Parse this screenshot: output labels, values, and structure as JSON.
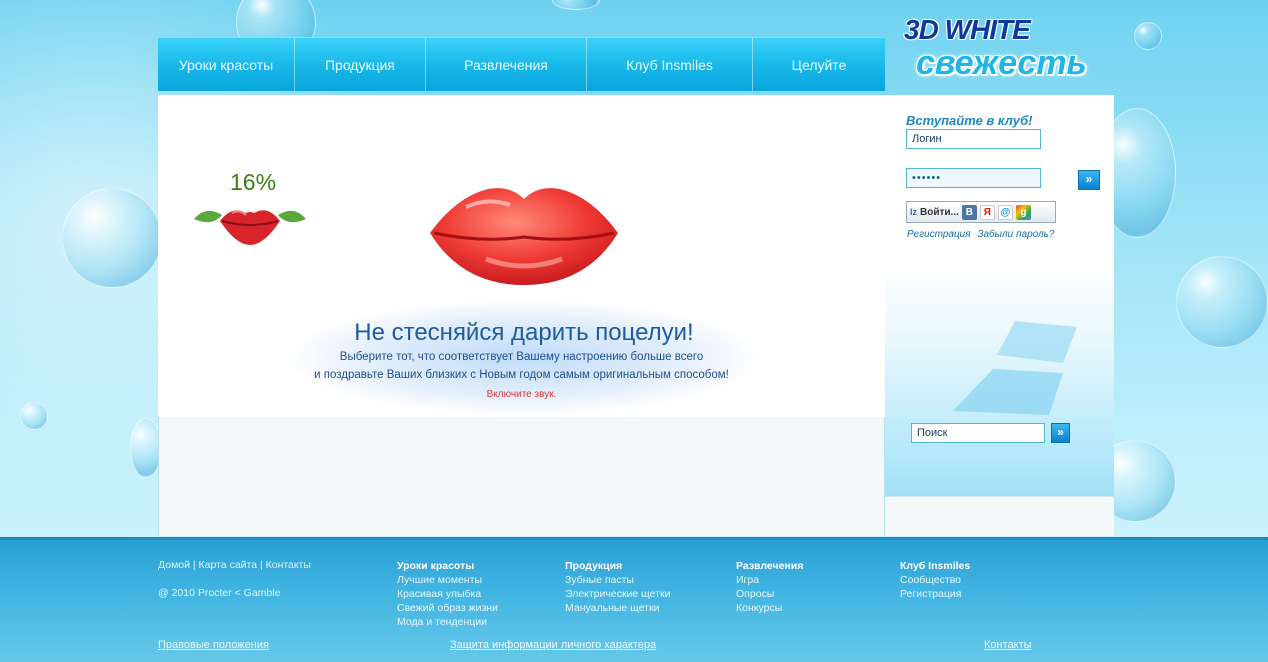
{
  "logo": {
    "line1": "3D WHITE",
    "line2": "свежесть"
  },
  "nav": {
    "items": [
      "Уроки красоты",
      "Продукция",
      "Развлечения",
      "Клуб Insmiles",
      "Целуйте"
    ]
  },
  "promo": {
    "progress_label": "16%",
    "progress": 0.16,
    "headline": "Не стесняйся дарить поцелуи!",
    "line1": "Выберите тот, что соответствует Вашему настроению больше всего",
    "line2": "и поздравьте Ваших близких с Новым годом самым оригинальным способом!",
    "sound_note": "Включите звук."
  },
  "sidebar": {
    "join_title": "Вступайте в клуб!",
    "login_value": "Логин",
    "password_value": "••••••",
    "submit_label": "»",
    "loginza_label": "Войти...",
    "loginza_logo": "lz",
    "social_icons": [
      "vkontakte-icon",
      "yandex-icon",
      "mailru-icon",
      "google-icon"
    ],
    "vk_glyph": "В",
    "yandex_glyph": "Я",
    "mail_glyph": "@",
    "google_glyph": "g",
    "register_link": "Регистрация",
    "forgot_link": "Забыли пароль?",
    "search_value": "Поиск",
    "search_button": "»"
  },
  "footer": {
    "top_links": "Домой | Карта сайта | Контакты",
    "copyright": "@ 2010 Procter < Gamble",
    "columns": [
      {
        "title": "Уроки красоты",
        "items": [
          "Лучшие моменты",
          "Красивая улыбка",
          "Свежий образ жизни",
          "Мода и тенденции"
        ]
      },
      {
        "title": "Продукция",
        "items": [
          "Зубные пасты",
          "Электрические щетки",
          "Мануальные щетки"
        ]
      },
      {
        "title": "Развлечения",
        "items": [
          "Игра",
          "Опросы",
          "Конкурсы"
        ]
      },
      {
        "title": "Клуб Insmiles",
        "items": [
          "Сообщество",
          "Регистрация"
        ]
      }
    ],
    "legal": "Правовые положения",
    "privacy": "Защита информации личного характера",
    "contacts": "Контакты"
  }
}
